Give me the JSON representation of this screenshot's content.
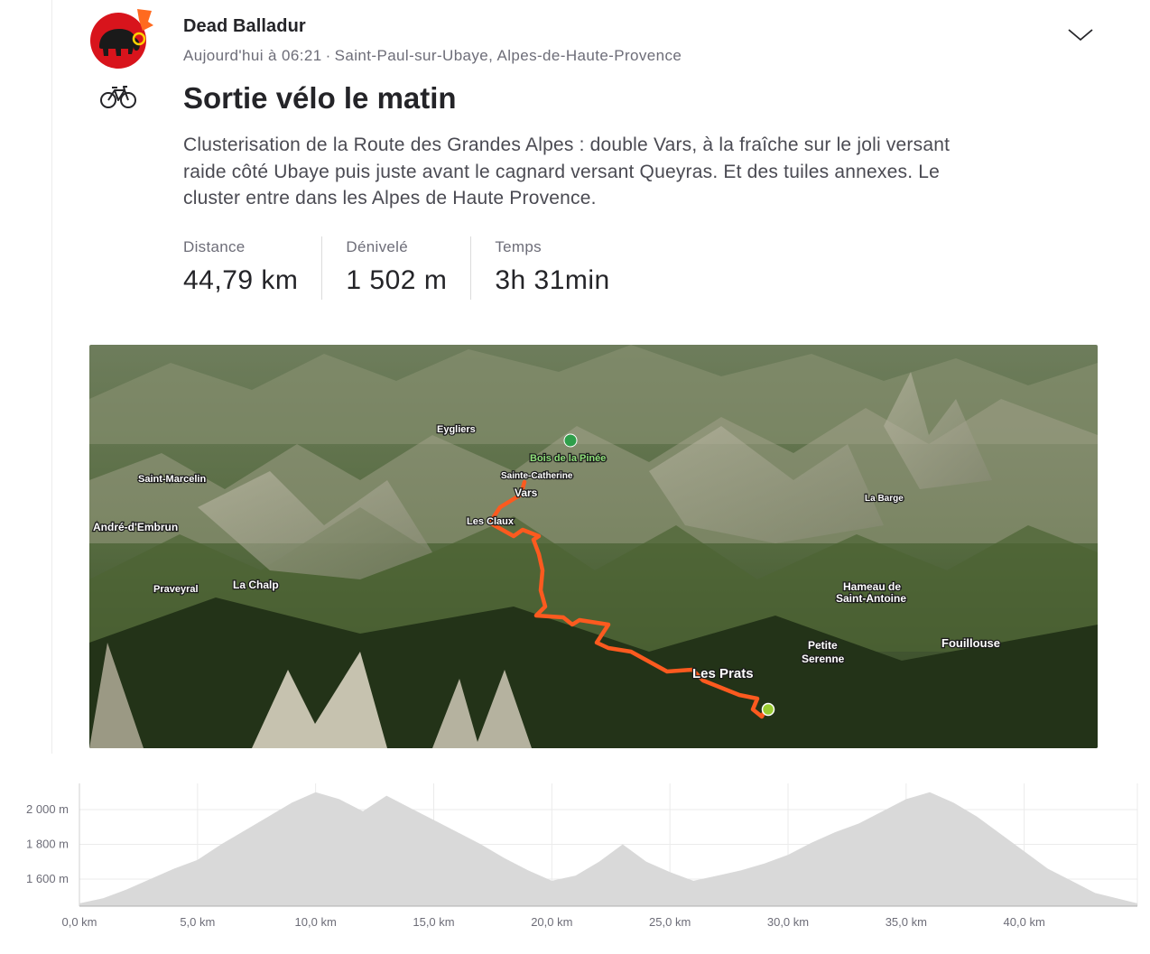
{
  "athlete": {
    "name": "Dead Balladur"
  },
  "meta": {
    "time": "Aujourd'hui à 06:21",
    "separator": "·",
    "location": "Saint-Paul-sur-Ubaye, Alpes-de-Haute-Provence"
  },
  "activity": {
    "sport_icon": "bicycle-icon",
    "title": "Sortie vélo le matin",
    "description": "Clusterisation de la Route des Grandes Alpes : double Vars, à la fraîche sur le joli versant raide côté Ubaye puis juste avant le cagnard versant Queyras. Et des tuiles annexes. Le cluster entre dans les Alpes de Haute Provence."
  },
  "stats": [
    {
      "label": "Distance",
      "value": "44,79 km"
    },
    {
      "label": "Dénivelé",
      "value": "1 502 m"
    },
    {
      "label": "Temps",
      "value": "3h 31min"
    }
  ],
  "map": {
    "labels": [
      "Eygliers",
      "Bois de la Pinée",
      "Saint-Marcelin",
      "Sainte-Catherine",
      "Vars",
      "Les Claux",
      "André-d'Embrun",
      "La Barge",
      "Praveyral",
      "La Chalp",
      "Hameau de",
      "Saint-Antoine",
      "Petite",
      "Serenne",
      "Fouillouse",
      "Les Prats"
    ],
    "route_color": "#fc5a1f",
    "finish_color": "#9acd32"
  },
  "elevation": {
    "y_ticks": [
      "2 000 m",
      "1 800 m",
      "1 600 m"
    ],
    "x_ticks": [
      "0,0 km",
      "5,0 km",
      "10,0 km",
      "15,0 km",
      "20,0 km",
      "25,0 km",
      "30,0 km",
      "35,0 km",
      "40,0 km"
    ],
    "profile_km": [
      0,
      1,
      2,
      3,
      4,
      5,
      6,
      7,
      8,
      9,
      10,
      11,
      12,
      13,
      14,
      15,
      16,
      17,
      18,
      19,
      20,
      21,
      22,
      23,
      24,
      25,
      26,
      27,
      28,
      29,
      30,
      31,
      32,
      33,
      34,
      35,
      36,
      37,
      38,
      39,
      40,
      41,
      42,
      43,
      44.79
    ],
    "profile_m": [
      1460,
      1490,
      1540,
      1600,
      1660,
      1710,
      1800,
      1880,
      1960,
      2040,
      2100,
      2060,
      1990,
      2080,
      2010,
      1940,
      1870,
      1800,
      1720,
      1650,
      1590,
      1620,
      1700,
      1800,
      1700,
      1640,
      1590,
      1620,
      1650,
      1690,
      1740,
      1810,
      1870,
      1920,
      1990,
      2060,
      2100,
      2040,
      1960,
      1860,
      1760,
      1660,
      1590,
      1520,
      1460
    ],
    "fill_color": "#d9d9d9"
  }
}
